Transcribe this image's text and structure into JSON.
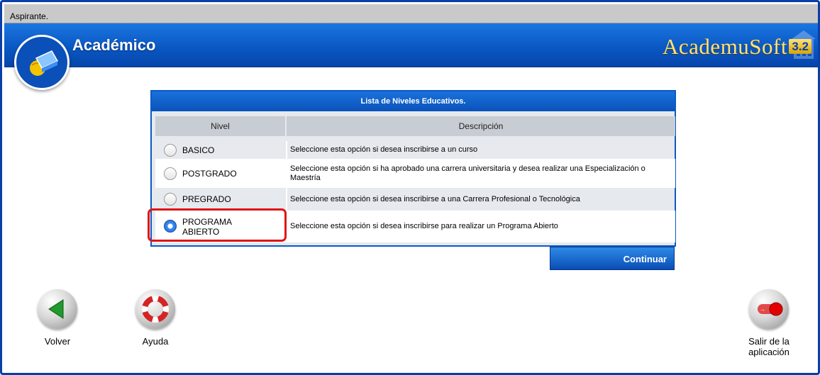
{
  "topbar": {
    "user": "Aspirante."
  },
  "header": {
    "section_title": "Académico",
    "brand": "AcademuSoft",
    "version": "3.2"
  },
  "table": {
    "title": "Lista de Niveles Educativos.",
    "col_nivel": "Nivel",
    "col_descripcion": "Descripción",
    "rows": [
      {
        "nivel": "BASICO",
        "descripcion": "Seleccione esta opción si desea inscribirse a un curso",
        "checked": false
      },
      {
        "nivel": "POSTGRADO",
        "descripcion": "Seleccione esta opción si ha aprobado una carrera universitaria y desea realizar una Especialización o Maestría",
        "checked": false
      },
      {
        "nivel": "PREGRADO",
        "descripcion": "Seleccione esta opción si desea inscribirse a una Carrera Profesional o Tecnológica",
        "checked": false
      },
      {
        "nivel": "PROGRAMA ABIERTO",
        "descripcion": "Seleccione esta opción si desea inscribirse para realizar un Programa Abierto",
        "checked": true
      }
    ]
  },
  "actions": {
    "continuar": "Continuar"
  },
  "toolbar": {
    "volver": "Volver",
    "ayuda": "Ayuda",
    "salir": "Salir de la aplicación"
  },
  "icons": {
    "logo": "book-globe-icon",
    "volver": "back-arrow-icon",
    "ayuda": "lifebuoy-icon",
    "salir": "exit-switch-icon"
  },
  "colors": {
    "header_blue": "#0a58c4",
    "frame_blue": "#0a3ea8",
    "brand_gold": "#ffe27a",
    "highlight_red": "#e01414"
  }
}
